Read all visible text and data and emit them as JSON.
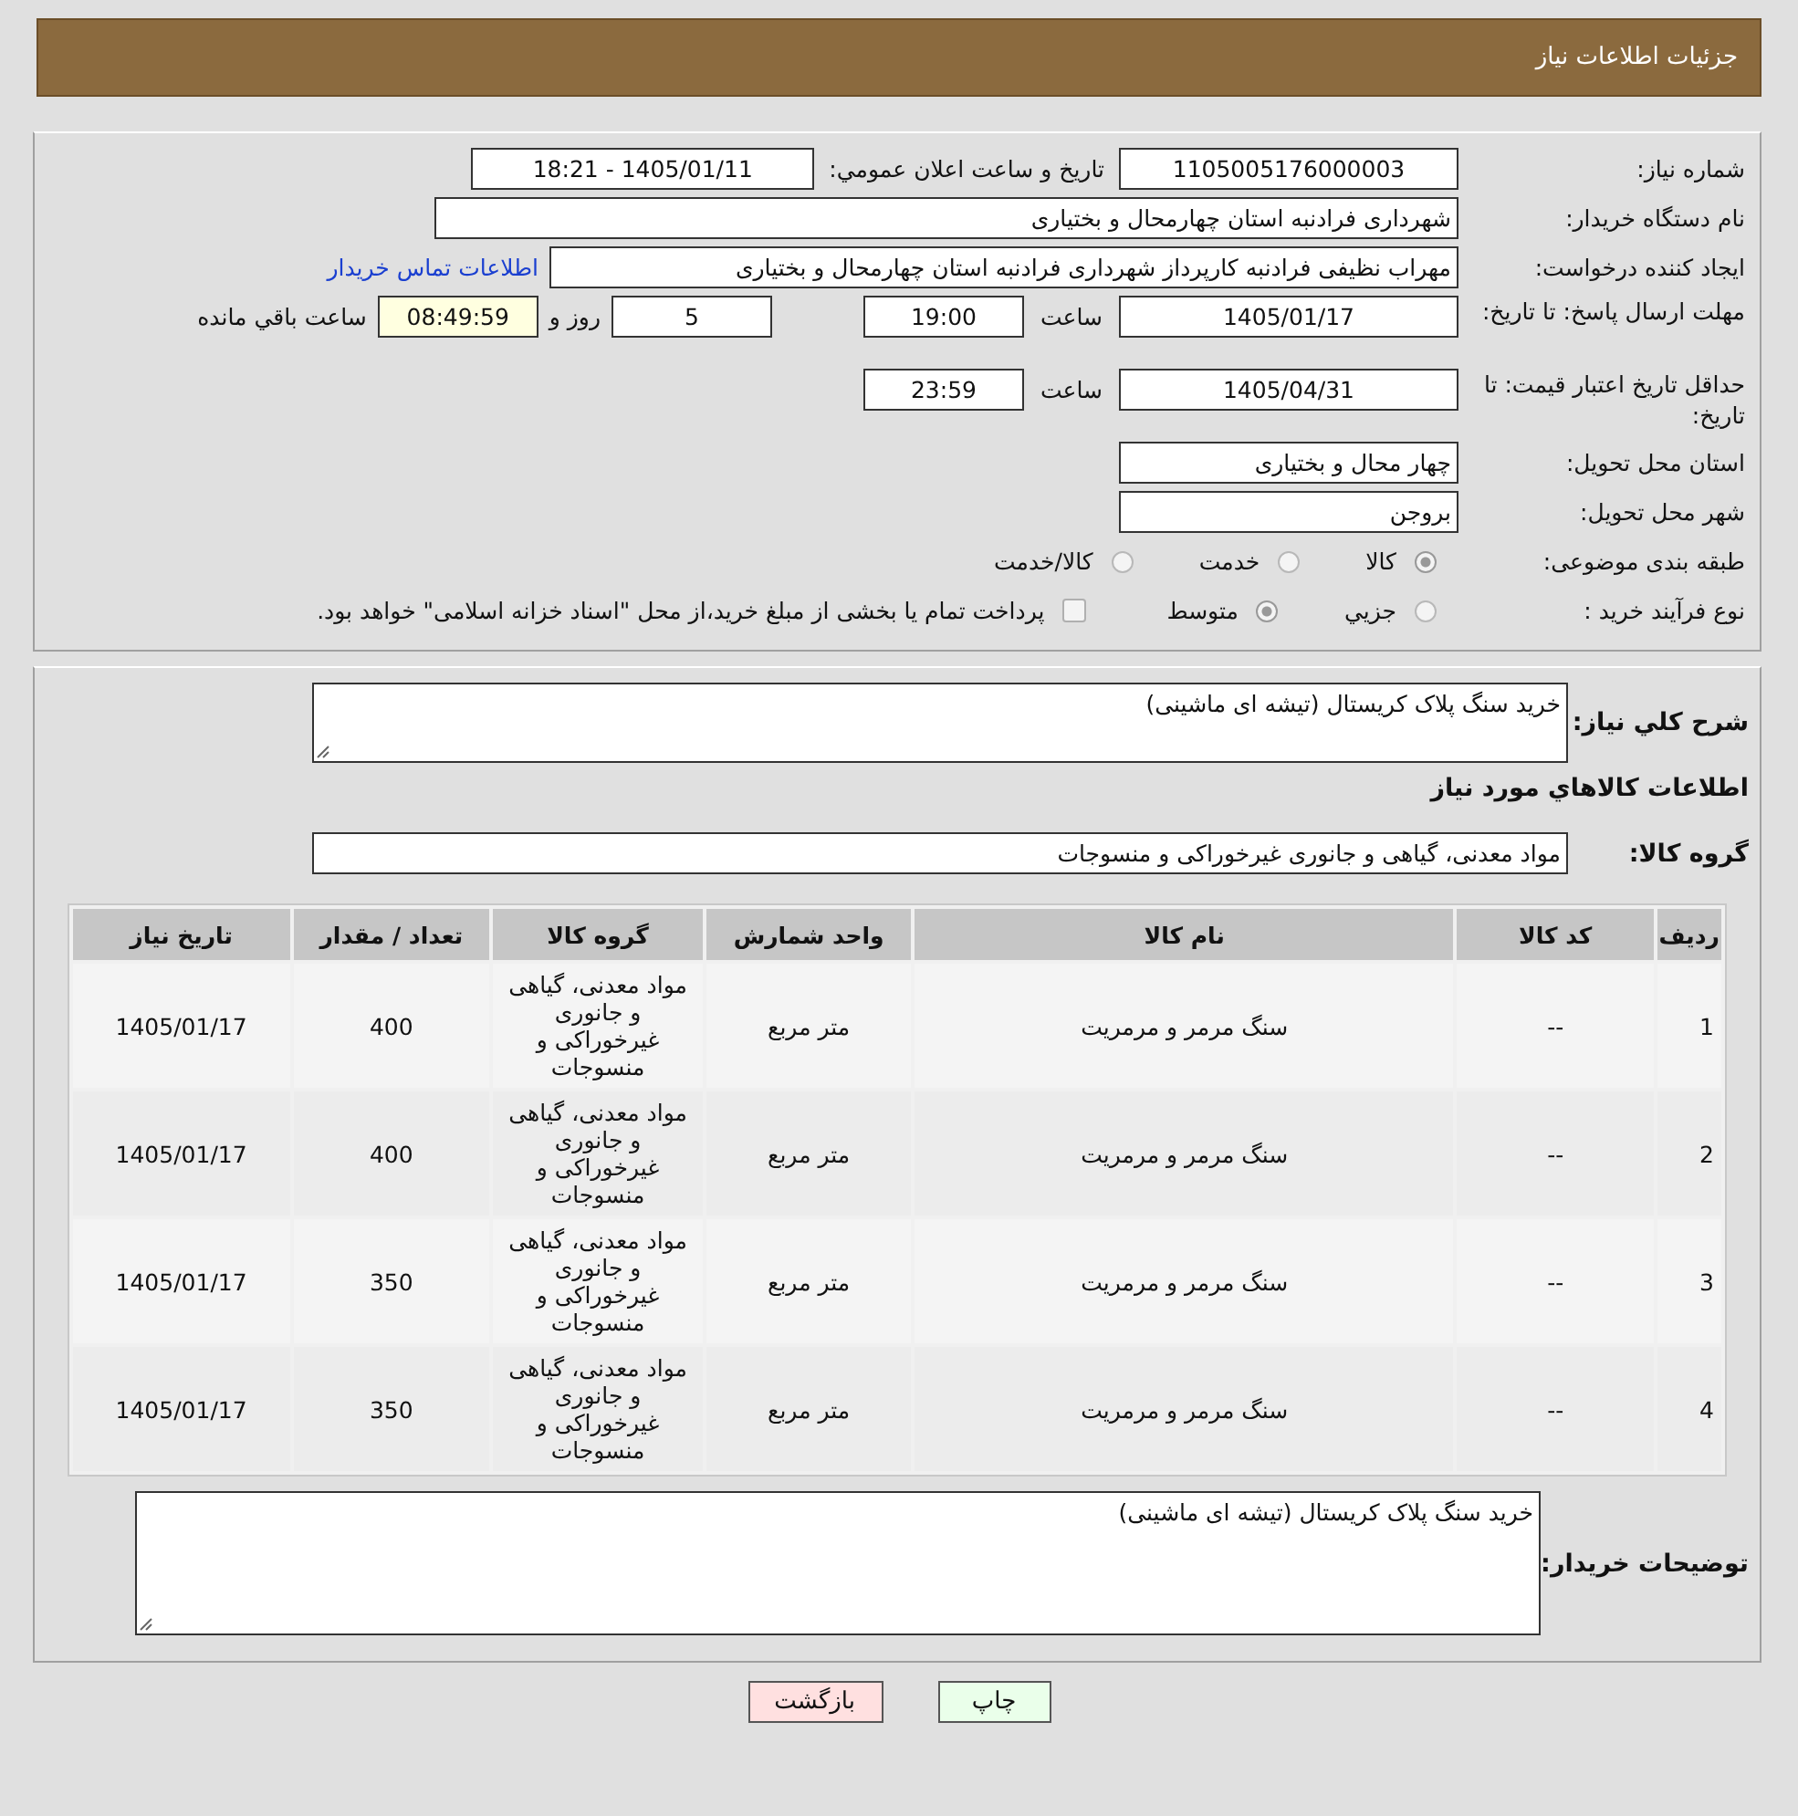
{
  "header": {
    "title": "جزئیات اطلاعات نیاز"
  },
  "need_number": {
    "label": "شماره نیاز:",
    "value": "1105005176000003"
  },
  "announce": {
    "label": "تاريخ و ساعت اعلان عمومي:",
    "value": "1405/01/11 - 18:21"
  },
  "buyer": {
    "label": "نام دستگاه خريدار:",
    "value": "شهرداری فرادنبه استان چهارمحال و بختیاری"
  },
  "requester": {
    "label": "ايجاد کننده درخواست:",
    "value": "مهراب نظیفی فرادنبه کارپرداز شهرداری فرادنبه استان چهارمحال و بختیاری",
    "link": "اطلاعات تماس خريدار"
  },
  "deadline": {
    "label": "مهلت ارسال پاسخ: تا تاريخ:",
    "date": "1405/01/17",
    "time_label": "ساعت",
    "time": "19:00",
    "days": "5",
    "days_label": "روز و",
    "remaining": "08:49:59",
    "remaining_label": "ساعت باقي مانده"
  },
  "validity": {
    "label": "حداقل تاريخ اعتبار قيمت: تا تاريخ:",
    "date": "1405/04/31",
    "time_label": "ساعت",
    "time": "23:59"
  },
  "province": {
    "label": "استان محل تحويل:",
    "value": "چهار محال و بختیاری"
  },
  "city": {
    "label": "شهر محل تحويل:",
    "value": "بروجن"
  },
  "category": {
    "label": "طبقه بندی موضوعی:",
    "options": [
      {
        "label": "کالا",
        "selected": true
      },
      {
        "label": "خدمت",
        "selected": false
      },
      {
        "label": "کالا/خدمت",
        "selected": false
      }
    ]
  },
  "process": {
    "label": "نوع فرآيند خريد :",
    "options": [
      {
        "label": "جزيي",
        "selected": false
      },
      {
        "label": "متوسط",
        "selected": true
      }
    ],
    "payment": {
      "label": "پرداخت تمام يا بخشی از مبلغ خريد،از محل \"اسناد خزانه اسلامی\" خواهد بود.",
      "checked": false
    }
  },
  "description": {
    "label": "شرح کلي نياز:",
    "value": "خريد سنگ پلاک کریستال (تیشه ای ماشینی)"
  },
  "goods_title": "اطلاعات کالاهاي مورد نياز",
  "group": {
    "label": "گروه کالا:",
    "value": "مواد معدنی، گیاهی و جانوری غیرخوراکی و منسوجات"
  },
  "table": {
    "columns": [
      "رديف",
      "کد کالا",
      "نام کالا",
      "واحد شمارش",
      "گروه کالا",
      "تعداد / مقدار",
      "تاريخ نياز"
    ],
    "rows": [
      [
        "1",
        "--",
        "سنگ مرمر و مرمریت",
        "متر مربع",
        "مواد معدنی، گیاهی و جانوری غیرخوراکی و منسوجات",
        "400",
        "1405/01/17"
      ],
      [
        "2",
        "--",
        "سنگ مرمر و مرمریت",
        "متر مربع",
        "مواد معدنی، گیاهی و جانوری غیرخوراکی و منسوجات",
        "400",
        "1405/01/17"
      ],
      [
        "3",
        "--",
        "سنگ مرمر و مرمریت",
        "متر مربع",
        "مواد معدنی، گیاهی و جانوری غیرخوراکی و منسوجات",
        "350",
        "1405/01/17"
      ],
      [
        "4",
        "--",
        "سنگ مرمر و مرمریت",
        "متر مربع",
        "مواد معدنی، گیاهی و جانوری غیرخوراکی و منسوجات",
        "350",
        "1405/01/17"
      ]
    ]
  },
  "buyer_notes": {
    "label": "توضيحات خريدار:",
    "value": "خريد سنگ پلاک کریستال (تیشه ای ماشینی)"
  },
  "buttons": [
    {
      "label": "چاپ",
      "kind": "print"
    },
    {
      "label": "بازگشت",
      "kind": "back"
    }
  ]
}
